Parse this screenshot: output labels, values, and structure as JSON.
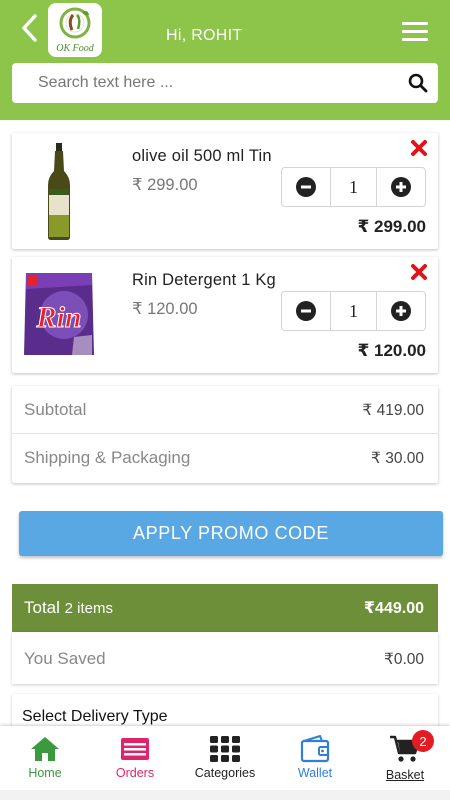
{
  "header": {
    "logo_text": "OK Food",
    "greeting": "Hi, ROHIT",
    "search_placeholder": "Search text here ...",
    "brand_color": "#8dc44a"
  },
  "cart_items": [
    {
      "name": "olive oil 500 ml Tin",
      "price": "₹ 299.00",
      "quantity": "1",
      "total": "₹ 299.00",
      "image": "olive-oil-bottle"
    },
    {
      "name": "Rin Detergent 1 Kg",
      "price": "₹ 120.00",
      "quantity": "1",
      "total": "₹ 120.00",
      "image": "rin-detergent-pack",
      "image_text": "Rin"
    }
  ],
  "summary": {
    "subtotal_label": "Subtotal",
    "subtotal_value": "₹ 419.00",
    "shipping_label": "Shipping & Packaging",
    "shipping_value": "₹ 30.00"
  },
  "promo": {
    "label": "APPLY PROMO CODE",
    "color": "#59a7e3"
  },
  "total": {
    "label": "Total",
    "items_count": "2 items",
    "value": "₹449.00",
    "color": "#6d8f3a"
  },
  "saved": {
    "label": "You Saved",
    "value": "₹0.00"
  },
  "delivery": {
    "label": "Select Delivery Type"
  },
  "nav": {
    "items": [
      {
        "label": "Home",
        "icon": "home-icon",
        "color": "#3b9a3e"
      },
      {
        "label": "Orders",
        "icon": "orders-icon",
        "color": "#e0246b"
      },
      {
        "label": "Categories",
        "icon": "grid-icon",
        "color": "#222222"
      },
      {
        "label": "Wallet",
        "icon": "wallet-icon",
        "color": "#2f7fd6"
      },
      {
        "label": "Basket",
        "icon": "cart-icon",
        "color": "#222222",
        "badge": "2"
      }
    ]
  }
}
